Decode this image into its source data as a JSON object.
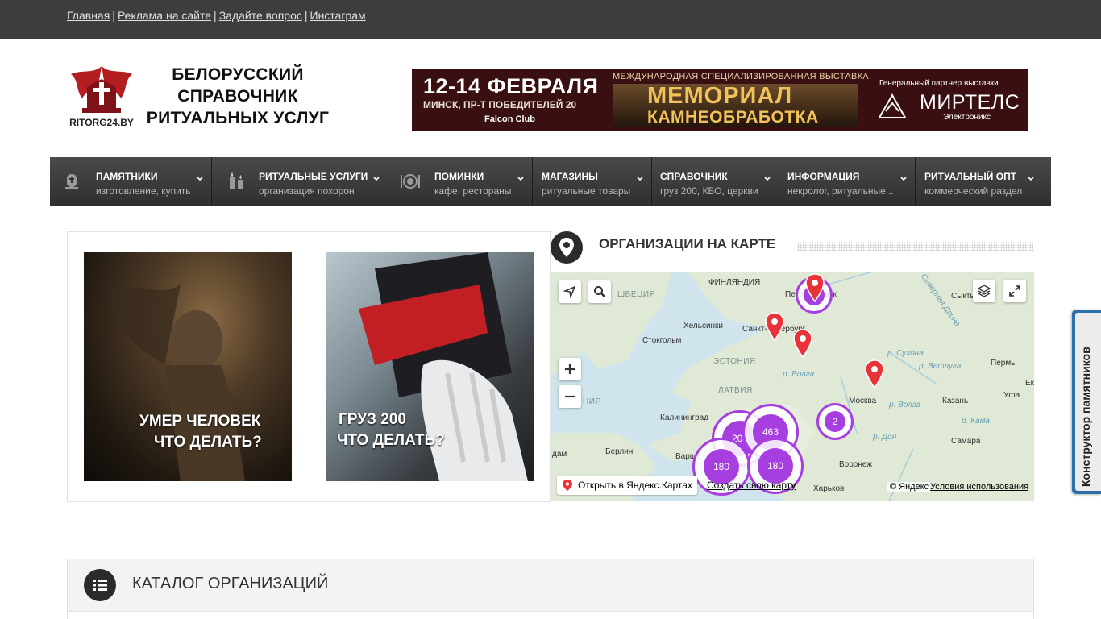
{
  "topbar": {
    "links": [
      "Главная",
      "Реклама на сайте",
      "Задайте вопрос",
      "Инстаграм"
    ],
    "separator": "|"
  },
  "header": {
    "logo_text": "RITORG24.BY",
    "title_lines": [
      "БЕЛОРУССКИЙ",
      "СПРАВОЧНИК",
      "РИТУАЛЬНЫХ УСЛУГ"
    ],
    "banner": {
      "date": "12-14 ФЕВРАЛЯ",
      "place": "МИНСК, ПР-Т ПОБЕДИТЕЛЕЙ 20",
      "club": "Falcon Club",
      "kicker": "МЕЖДУНАРОДНАЯ СПЕЦИАЛИЗИРОВАННАЯ ВЫСТАВКА",
      "event": "МЕМОРИАЛ",
      "event_sub": "КАМНЕОБРАБОТКА",
      "partner_label": "Генеральный партнер выставки",
      "partner": "МИРТЕЛС",
      "partner_sub": "Электроникс"
    }
  },
  "nav": [
    {
      "label": "ПАМЯТНИКИ",
      "sub": "изготовление, купить",
      "icon": "monument-icon"
    },
    {
      "label": "РИТУАЛЬНЫЕ УСЛУГИ",
      "sub": "организация похорон",
      "icon": "candle-icon"
    },
    {
      "label": "ПОМИНКИ",
      "sub": "кафе, рестораны",
      "icon": "dinner-plate-icon"
    },
    {
      "label": "МАГАЗИНЫ",
      "sub": "ритуальные товары",
      "icon": ""
    },
    {
      "label": "СПРАВОЧНИК",
      "sub": "груз 200, КБО, церкви",
      "icon": ""
    },
    {
      "label": "ИНФОРМАЦИЯ",
      "sub": "некролог, ритуальные...",
      "icon": ""
    },
    {
      "label": "РИТУАЛЬНЫЙ ОПТ",
      "sub": "коммерческий раздел",
      "icon": ""
    }
  ],
  "cards": [
    {
      "lines": [
        "УМЕР ЧЕЛОВЕК",
        "ЧТО ДЕЛАТЬ?"
      ]
    },
    {
      "lines": [
        "ГРУЗ 200",
        "ЧТО ДЕЛАТЬ?"
      ]
    }
  ],
  "map_section": {
    "title": "ОРГАНИЗАЦИИ НА КАРТЕ",
    "places": {
      "finland": "ФИНЛЯНДИЯ",
      "sweden": "ШВЕЦИЯ",
      "estonia": "ЭСТОНИЯ",
      "latvia": "ЛАТВИЯ",
      "lithuania_partial": "НИЯ",
      "helsinki": "Хельсинки",
      "stockholm": "Стокгольм",
      "spb": "Санкт-Петербург",
      "petroz": "Петрозаводск",
      "syktyvkar": "Сыктывкар",
      "perm": "Пермь",
      "moscow": "Москва",
      "kazan": "Казань",
      "ufa": "Уфа",
      "samara": "Самара",
      "voronezh": "Воронеж",
      "kharkov": "Харьков",
      "berlin": "Берлин",
      "warsaw": "Варша",
      "kaliningrad": "Калининград",
      "dam": "дам",
      "ekb_partial": "Ек",
      "volga1": "р. Волга",
      "volga2": "р. Волга",
      "sukhona": "р. Сухона",
      "vetluga": "р. Ветлуга",
      "kama": "р. Кама",
      "don": "р. Дон",
      "dvina": "Северная Двина"
    },
    "clusters": {
      "c1": "2",
      "c2": "463",
      "c3": "206",
      "c4": "180",
      "c5": "180",
      "c6": "2"
    },
    "open_yandex": "Открыть в Яндекс.Картах",
    "create_map": "Создать свою карту",
    "copyright": "© Яндекс",
    "terms": "Условия использования"
  },
  "side_tab": {
    "label": "Конструктор памятников"
  },
  "catalog": {
    "title": "КАТАЛОГ ОРГАНИЗАЦИЙ"
  },
  "colors": {
    "topbar": "#3d3d3d",
    "nav": "#3a3a3a",
    "cluster": "#a63ee0",
    "pin": "#e8333a",
    "side_tab": "#2d6fa9",
    "banner": "#3a0f12"
  }
}
